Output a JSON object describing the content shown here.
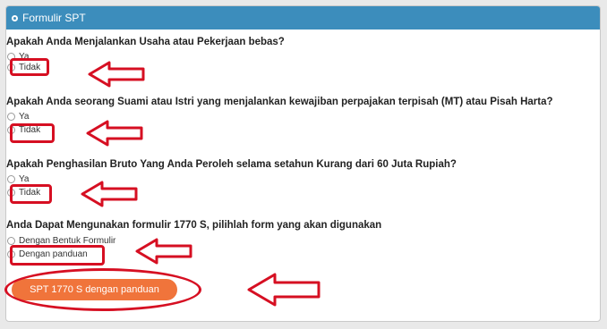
{
  "panel": {
    "title": "Formulir SPT",
    "title_icon": "circle-info-icon",
    "header_color": "#3c8dbc"
  },
  "questions": [
    {
      "text": "Apakah Anda Menjalankan Usaha atau Pekerjaan bebas?",
      "options": [
        {
          "label": "Ya",
          "checked": false
        },
        {
          "label": "Tidak",
          "checked": true
        }
      ]
    },
    {
      "text": "Apakah Anda seorang Suami atau Istri yang menjalankan kewajiban perpajakan terpisah (MT) atau Pisah Harta?",
      "options": [
        {
          "label": "Ya",
          "checked": false
        },
        {
          "label": "Tidak",
          "checked": true
        }
      ]
    },
    {
      "text": "Apakah Penghasilan Bruto Yang Anda Peroleh selama setahun Kurang dari 60 Juta Rupiah?",
      "options": [
        {
          "label": "Ya",
          "checked": false
        },
        {
          "label": "Tidak",
          "checked": true
        }
      ]
    },
    {
      "text": "Anda Dapat Mengunakan formulir 1770 S, pilihlah form yang akan digunakan",
      "options": [
        {
          "label": "Dengan Bentuk Formulir",
          "checked": false
        },
        {
          "label": "Dengan panduan",
          "checked": true
        }
      ]
    }
  ],
  "submit_button": {
    "label": "SPT 1770 S dengan panduan",
    "color": "#f0743b"
  },
  "annotation_color": "#d60f22"
}
